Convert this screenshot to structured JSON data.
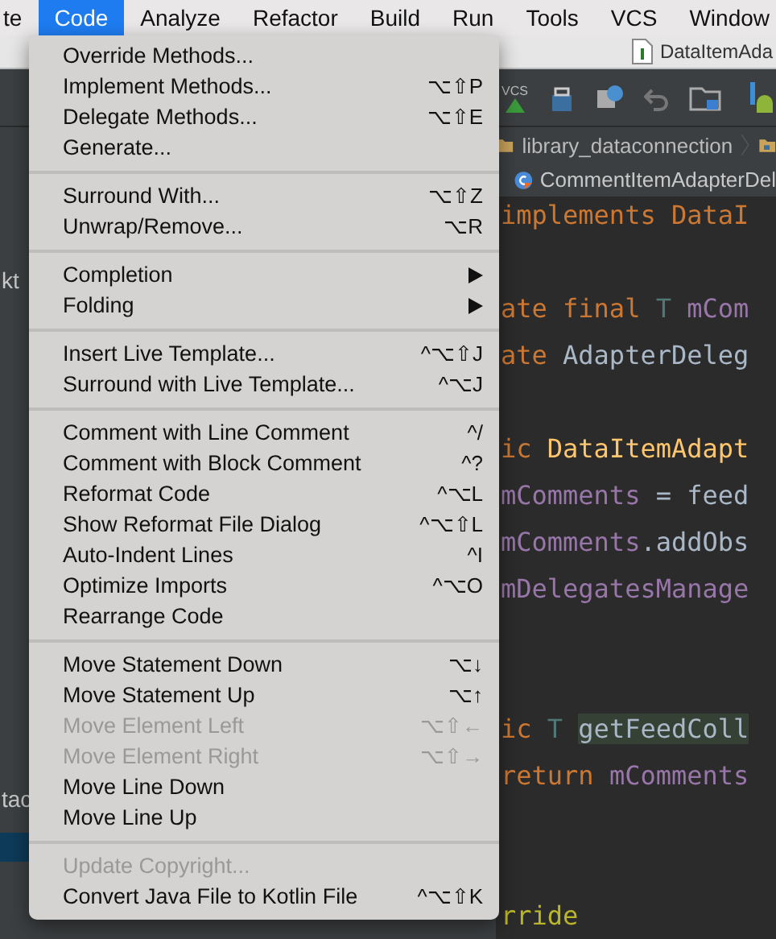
{
  "menu_bar": [
    {
      "label": "te",
      "selected": false
    },
    {
      "label": "Code",
      "selected": true
    },
    {
      "label": "Analyze",
      "selected": false
    },
    {
      "label": "Refactor",
      "selected": false
    },
    {
      "label": "Build",
      "selected": false
    },
    {
      "label": "Run",
      "selected": false
    },
    {
      "label": "Tools",
      "selected": false
    },
    {
      "label": "VCS",
      "selected": false
    },
    {
      "label": "Window",
      "selected": false
    }
  ],
  "editor_tab": {
    "title": "DataItemAda"
  },
  "toolbar": {
    "vcs_label": "VCS"
  },
  "breadcrumb": {
    "path": "library_dataconnection"
  },
  "file_tab": {
    "title": "CommentItemAdapterDel"
  },
  "project_tree": [
    {
      "text": "kt",
      "selected": false
    },
    {
      "text": "tac",
      "selected": false
    },
    {
      "selected": true
    }
  ],
  "code_lines": [
    [
      {
        "text": "implements DataI",
        "kind": "keyword"
      }
    ],
    [
      {
        "text": "ate final ",
        "kind": "keyword"
      },
      {
        "text": "T ",
        "kind": "type"
      },
      {
        "text": "mCom",
        "kind": "field"
      }
    ],
    [
      {
        "text": "ate ",
        "kind": "keyword"
      },
      {
        "text": "AdapterDeleg",
        "kind": "plain"
      }
    ],
    [
      {
        "text": "ic ",
        "kind": "keyword"
      },
      {
        "text": "DataItemAdapt",
        "kind": "method"
      }
    ],
    [
      {
        "text": "mComments",
        "kind": "field"
      },
      {
        "text": " = feed",
        "kind": "plain"
      }
    ],
    [
      {
        "text": "mComments",
        "kind": "field"
      },
      {
        "text": ".addObs",
        "kind": "plain"
      }
    ],
    [
      {
        "text": "mDelegatesManage",
        "kind": "field"
      }
    ],
    [
      {
        "text": "ic ",
        "kind": "keyword"
      },
      {
        "text": "T ",
        "kind": "type"
      },
      {
        "text": "getFeedColl",
        "kind": "highlight"
      }
    ],
    [
      {
        "text": "return ",
        "kind": "keyword"
      },
      {
        "text": "mComments",
        "kind": "field"
      }
    ],
    [
      {
        "text": "rride",
        "kind": "annotation"
      }
    ]
  ],
  "code_menu": [
    {
      "kind": "item",
      "label": "Override Methods...",
      "disabled": false
    },
    {
      "kind": "item",
      "label": "Implement Methods...",
      "shortcut": "⌥⇧P",
      "disabled": false
    },
    {
      "kind": "item",
      "label": "Delegate Methods...",
      "shortcut": "⌥⇧E",
      "disabled": false
    },
    {
      "kind": "item",
      "label": "Generate...",
      "disabled": false
    },
    {
      "kind": "separator"
    },
    {
      "kind": "item",
      "label": "Surround With...",
      "shortcut": "⌥⇧Z",
      "disabled": false
    },
    {
      "kind": "item",
      "label": "Unwrap/Remove...",
      "shortcut": "⌥R",
      "disabled": false
    },
    {
      "kind": "separator"
    },
    {
      "kind": "submenu",
      "label": "Completion",
      "disabled": false
    },
    {
      "kind": "submenu",
      "label": "Folding",
      "disabled": false
    },
    {
      "kind": "separator"
    },
    {
      "kind": "item",
      "label": "Insert Live Template...",
      "shortcut": "^⌥⇧J",
      "disabled": false
    },
    {
      "kind": "item",
      "label": "Surround with Live Template...",
      "shortcut": "^⌥J",
      "disabled": false
    },
    {
      "kind": "separator"
    },
    {
      "kind": "item",
      "label": "Comment with Line Comment",
      "shortcut": "^/",
      "disabled": false
    },
    {
      "kind": "item",
      "label": "Comment with Block Comment",
      "shortcut": "^?",
      "disabled": false
    },
    {
      "kind": "item",
      "label": "Reformat Code",
      "shortcut": "^⌥L",
      "disabled": false
    },
    {
      "kind": "item",
      "label": "Show Reformat File Dialog",
      "shortcut": "^⌥⇧L",
      "disabled": false
    },
    {
      "kind": "item",
      "label": "Auto-Indent Lines",
      "shortcut": "^I",
      "disabled": false
    },
    {
      "kind": "item",
      "label": "Optimize Imports",
      "shortcut": "^⌥O",
      "disabled": false
    },
    {
      "kind": "item",
      "label": "Rearrange Code",
      "disabled": false
    },
    {
      "kind": "separator"
    },
    {
      "kind": "item",
      "label": "Move Statement Down",
      "shortcut": "⌥↓",
      "disabled": false
    },
    {
      "kind": "item",
      "label": "Move Statement Up",
      "shortcut": "⌥↑",
      "disabled": false
    },
    {
      "kind": "item",
      "label": "Move Element Left",
      "shortcut": "⌥⇧←",
      "disabled": true
    },
    {
      "kind": "item",
      "label": "Move Element Right",
      "shortcut": "⌥⇧→",
      "disabled": true
    },
    {
      "kind": "item",
      "label": "Move Line Down",
      "disabled": false
    },
    {
      "kind": "item",
      "label": "Move Line Up",
      "disabled": false
    },
    {
      "kind": "separator"
    },
    {
      "kind": "item",
      "label": "Update Copyright...",
      "disabled": true
    },
    {
      "kind": "item",
      "label": "Convert Java File to Kotlin File",
      "shortcut": "^⌥⇧K",
      "disabled": false
    }
  ]
}
